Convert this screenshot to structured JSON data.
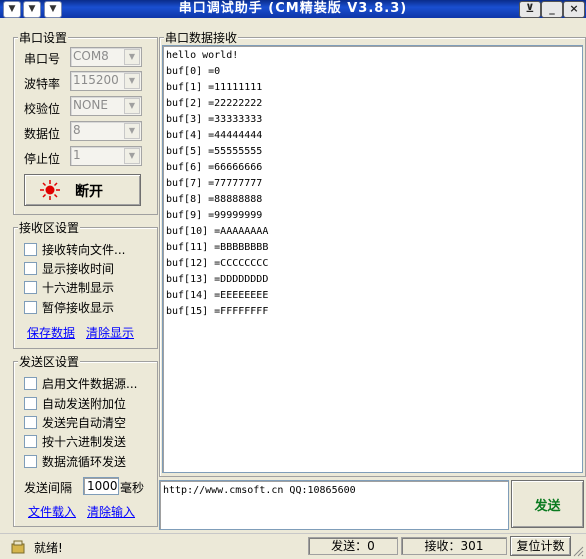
{
  "window": {
    "title": "串口调试助手 (CM精装版 V3.8.3)"
  },
  "serial_settings": {
    "group_title": "串口设置",
    "rows": [
      {
        "label": "串口号",
        "value": "COM8"
      },
      {
        "label": "波特率",
        "value": "115200"
      },
      {
        "label": "校验位",
        "value": "NONE"
      },
      {
        "label": "数据位",
        "value": "8"
      },
      {
        "label": "停止位",
        "value": "1"
      }
    ],
    "toggle_button": "断开",
    "indicator_color": "#e00000"
  },
  "receive_settings": {
    "group_title": "接收区设置",
    "options": [
      "接收转向文件...",
      "显示接收时间",
      "十六进制显示",
      "暂停接收显示"
    ],
    "save_link": "保存数据",
    "clear_link": "清除显示"
  },
  "send_settings": {
    "group_title": "发送区设置",
    "options": [
      "启用文件数据源...",
      "自动发送附加位",
      "发送完自动清空",
      "按十六进制发送",
      "数据流循环发送"
    ],
    "interval_label": "发送间隔",
    "interval_value": "1000",
    "interval_unit": "毫秒",
    "load_link": "文件载入",
    "clear_link": "清除输入"
  },
  "receive_area": {
    "group_title": "串口数据接收",
    "lines": [
      "hello world!",
      "buf[0] =0",
      "buf[1] =11111111",
      "buf[2] =22222222",
      "buf[3] =33333333",
      "buf[4] =44444444",
      "buf[5] =55555555",
      "buf[6] =66666666",
      "buf[7] =77777777",
      "buf[8] =88888888",
      "buf[9] =99999999",
      "buf[10] =AAAAAAAA",
      "buf[11] =BBBBBBBB",
      "buf[12] =CCCCCCCC",
      "buf[13] =DDDDDDDD",
      "buf[14] =EEEEEEEE",
      "buf[15] =FFFFFFFF"
    ]
  },
  "send_area": {
    "text": "http://www.cmsoft.cn QQ:10865600",
    "send_button": "发送"
  },
  "status_bar": {
    "status": "就绪!",
    "sent": "发送：0",
    "received": "接收：301",
    "reset_button": "复位计数"
  }
}
